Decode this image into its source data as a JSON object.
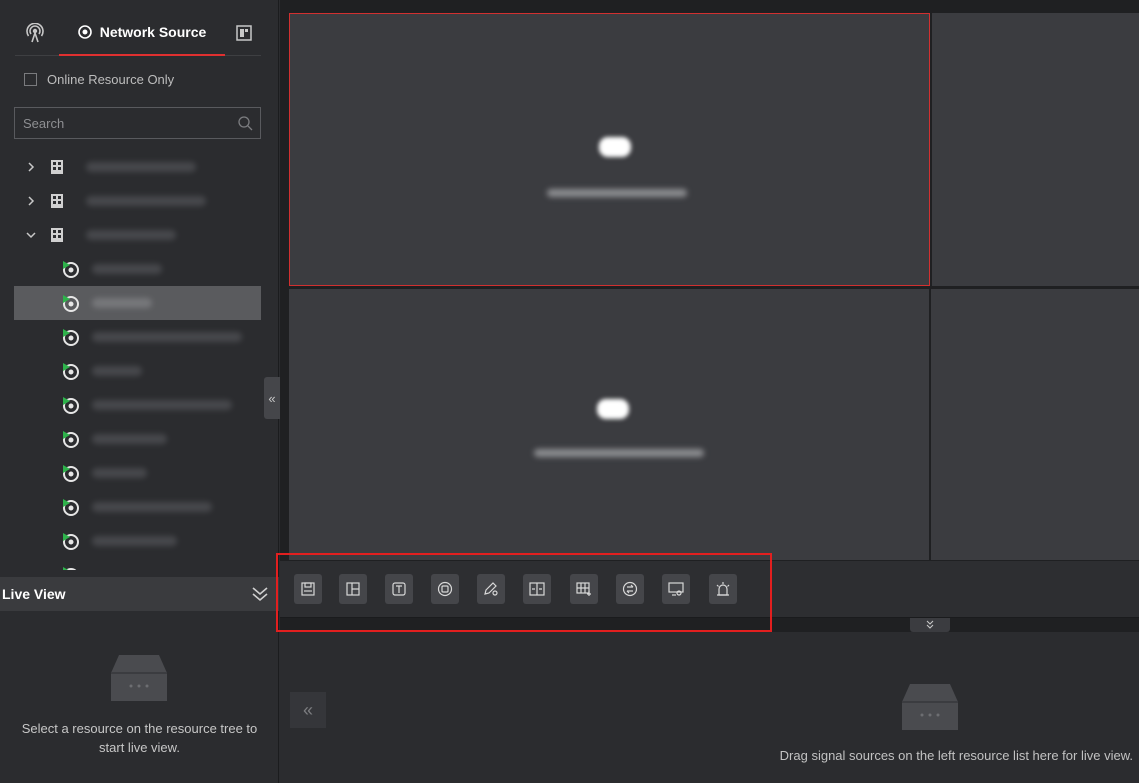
{
  "left_panel": {
    "tabs": [
      {
        "name": "resource",
        "icon": "signal-icon"
      },
      {
        "name": "network",
        "label": "Network Source",
        "icon": "network-source-icon"
      },
      {
        "name": "view",
        "icon": "view-icon"
      }
    ],
    "online_only_label": "Online Resource Only",
    "online_only_checked": false,
    "search": {
      "placeholder": "Search",
      "value": ""
    },
    "collapse_symbol": "«"
  },
  "live_view": {
    "title": "Live View",
    "empty_message": "Select a resource on the resource tree to start live view."
  },
  "toolbar": {
    "tools": [
      {
        "name": "save-view-icon"
      },
      {
        "name": "window-division-icon"
      },
      {
        "name": "text-overlay-icon"
      },
      {
        "name": "roaming-icon"
      },
      {
        "name": "edit-icon"
      },
      {
        "name": "split-screen-icon"
      },
      {
        "name": "grid-add-icon"
      },
      {
        "name": "switch-icon"
      },
      {
        "name": "screen-view-icon"
      },
      {
        "name": "alarm-icon"
      }
    ]
  },
  "bottom": {
    "empty_message": "Drag signal sources on the left resource list here for live view.",
    "left_arrow": "«",
    "down_symbol": "≫"
  },
  "colors": {
    "accent": "#e03030",
    "panel_bg": "#2b2c2f",
    "tile_bg": "#3b3c40",
    "camera_green": "#2eb24b"
  }
}
